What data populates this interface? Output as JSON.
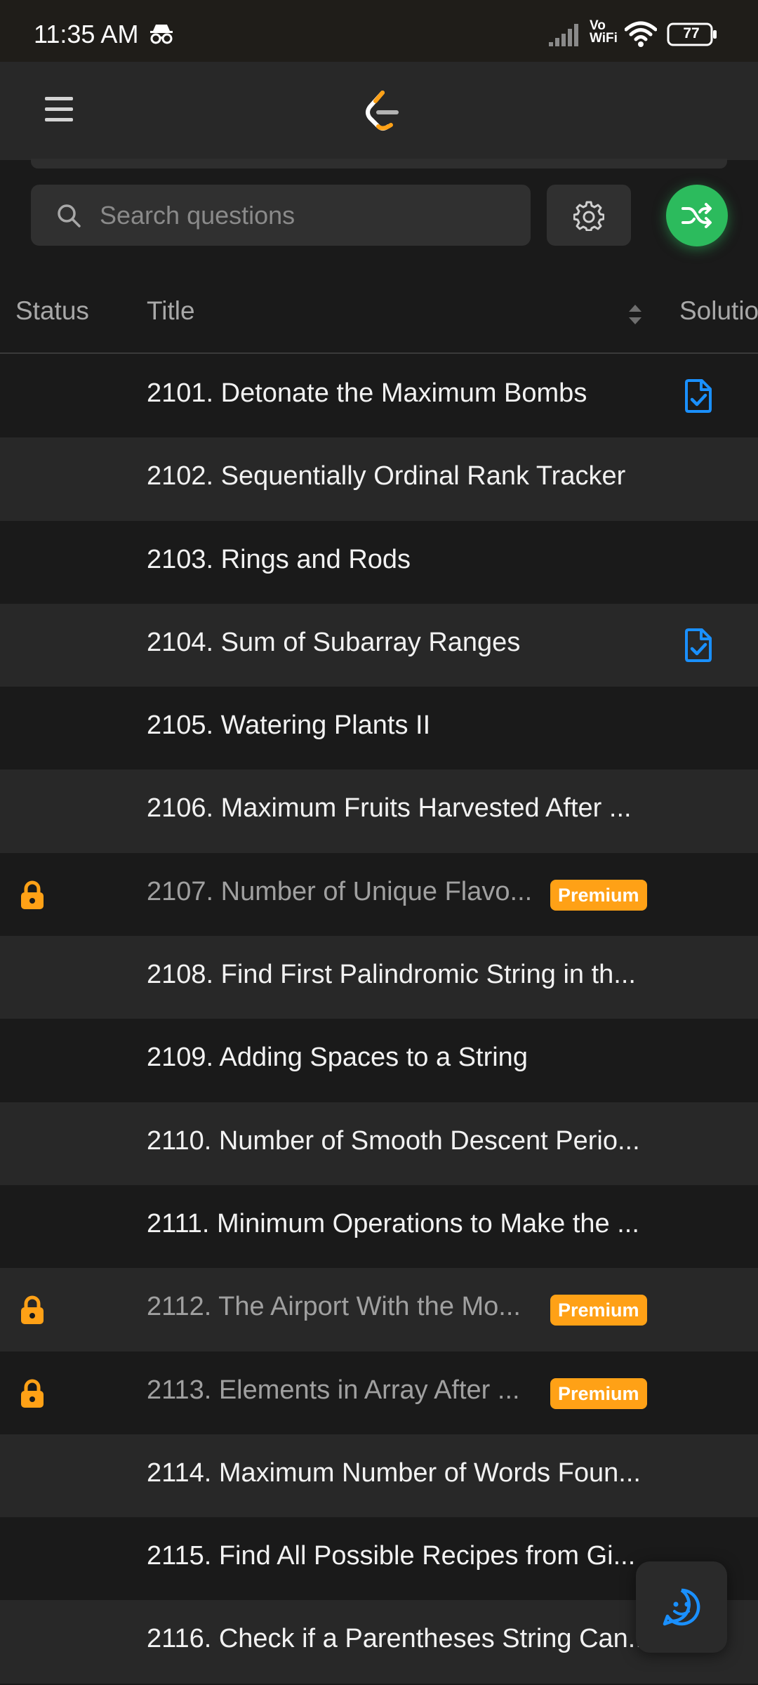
{
  "status_bar": {
    "time": "11:35 AM",
    "vo": "Vo",
    "wifi_label": "WiFi",
    "battery": "77"
  },
  "header": {
    "menu_icon": "hamburger-icon",
    "logo_icon": "leetcode-logo-icon"
  },
  "search": {
    "placeholder": "Search questions",
    "value": ""
  },
  "toolbar": {
    "settings_icon": "gear-icon",
    "shuffle_icon": "shuffle-icon",
    "shuffle_color": "#2cbb5d"
  },
  "table": {
    "columns": [
      "Status",
      "Title",
      "Solution"
    ],
    "rows": [
      {
        "title": "2101. Detonate the Maximum Bombs",
        "locked": false,
        "premium": false,
        "solution": true
      },
      {
        "title": "2102. Sequentially Ordinal Rank Tracker",
        "locked": false,
        "premium": false,
        "solution": false
      },
      {
        "title": "2103. Rings and Rods",
        "locked": false,
        "premium": false,
        "solution": false
      },
      {
        "title": "2104. Sum of Subarray Ranges",
        "locked": false,
        "premium": false,
        "solution": true
      },
      {
        "title": "2105. Watering Plants II",
        "locked": false,
        "premium": false,
        "solution": false
      },
      {
        "title": "2106. Maximum Fruits Harvested After ...",
        "locked": false,
        "premium": false,
        "solution": false
      },
      {
        "title": "2107. Number of Unique Flavo...",
        "locked": true,
        "premium": true,
        "solution": false
      },
      {
        "title": "2108. Find First Palindromic String in th...",
        "locked": false,
        "premium": false,
        "solution": false
      },
      {
        "title": "2109. Adding Spaces to a String",
        "locked": false,
        "premium": false,
        "solution": false
      },
      {
        "title": "2110. Number of Smooth Descent Perio...",
        "locked": false,
        "premium": false,
        "solution": false
      },
      {
        "title": "2111. Minimum Operations to Make the ...",
        "locked": false,
        "premium": false,
        "solution": false
      },
      {
        "title": "2112. The Airport With the Mo...",
        "locked": true,
        "premium": true,
        "solution": false
      },
      {
        "title": "2113. Elements in Array After ...",
        "locked": true,
        "premium": true,
        "solution": false
      },
      {
        "title": "2114. Maximum Number of Words Foun...",
        "locked": false,
        "premium": false,
        "solution": false
      },
      {
        "title": "2115. Find All Possible Recipes from Gi...",
        "locked": false,
        "premium": false,
        "solution": false
      },
      {
        "title": "2116. Check if a Parentheses String Can...",
        "locked": false,
        "premium": false,
        "solution": false
      }
    ],
    "premium_label": "Premium",
    "premium_color": "#ffa116",
    "lock_color": "#ffa116",
    "solution_color": "#1a90ff"
  },
  "chat": {
    "icon": "chat-smile-icon"
  }
}
